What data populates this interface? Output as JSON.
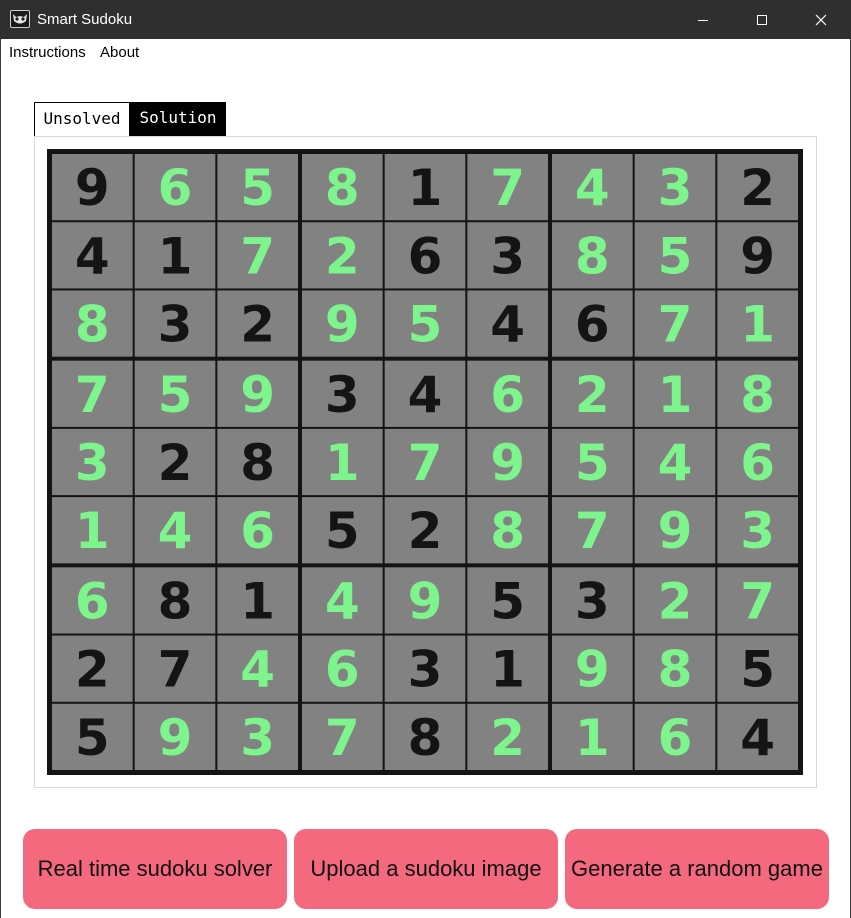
{
  "window": {
    "title": "Smart Sudoku",
    "app_icon": "owl-icon",
    "controls": [
      "minimize-icon",
      "maximize-icon",
      "close-icon"
    ]
  },
  "menu": {
    "instructions": "Instructions",
    "about": "About"
  },
  "tabs": {
    "unsolved": "Unsolved",
    "solution": "Solution",
    "active": "Solution"
  },
  "board": {
    "grid": [
      [
        9,
        6,
        5,
        8,
        1,
        7,
        4,
        3,
        2
      ],
      [
        4,
        1,
        7,
        2,
        6,
        3,
        8,
        5,
        9
      ],
      [
        8,
        3,
        2,
        9,
        5,
        4,
        6,
        7,
        1
      ],
      [
        7,
        5,
        9,
        3,
        4,
        6,
        2,
        1,
        8
      ],
      [
        3,
        2,
        8,
        1,
        7,
        9,
        5,
        4,
        6
      ],
      [
        1,
        4,
        6,
        5,
        2,
        8,
        7,
        9,
        3
      ],
      [
        6,
        8,
        1,
        4,
        9,
        5,
        3,
        2,
        7
      ],
      [
        2,
        7,
        4,
        6,
        3,
        1,
        9,
        8,
        5
      ],
      [
        5,
        9,
        3,
        7,
        8,
        2,
        1,
        6,
        4
      ]
    ],
    "given_mask": [
      [
        1,
        0,
        0,
        0,
        1,
        0,
        0,
        0,
        1
      ],
      [
        1,
        1,
        0,
        0,
        1,
        1,
        0,
        0,
        1
      ],
      [
        0,
        1,
        1,
        0,
        0,
        1,
        1,
        0,
        0
      ],
      [
        0,
        0,
        0,
        1,
        1,
        0,
        0,
        0,
        0
      ],
      [
        0,
        1,
        1,
        0,
        0,
        0,
        0,
        0,
        0
      ],
      [
        0,
        0,
        0,
        1,
        1,
        0,
        0,
        0,
        0
      ],
      [
        0,
        1,
        1,
        0,
        0,
        1,
        1,
        0,
        0
      ],
      [
        1,
        1,
        0,
        0,
        1,
        1,
        0,
        0,
        1
      ],
      [
        1,
        0,
        0,
        0,
        1,
        0,
        0,
        0,
        1
      ]
    ],
    "colors": {
      "given": "#141414",
      "solved": "#7df58c",
      "cell": "#828282",
      "grid": "#141414"
    }
  },
  "buttons": {
    "realtime": "Real time sudoku solver",
    "upload": "Upload a sudoku image",
    "generate": "Generate a random game"
  },
  "colors": {
    "titlebar": "#2f2f2f",
    "button": "#f5697f"
  }
}
